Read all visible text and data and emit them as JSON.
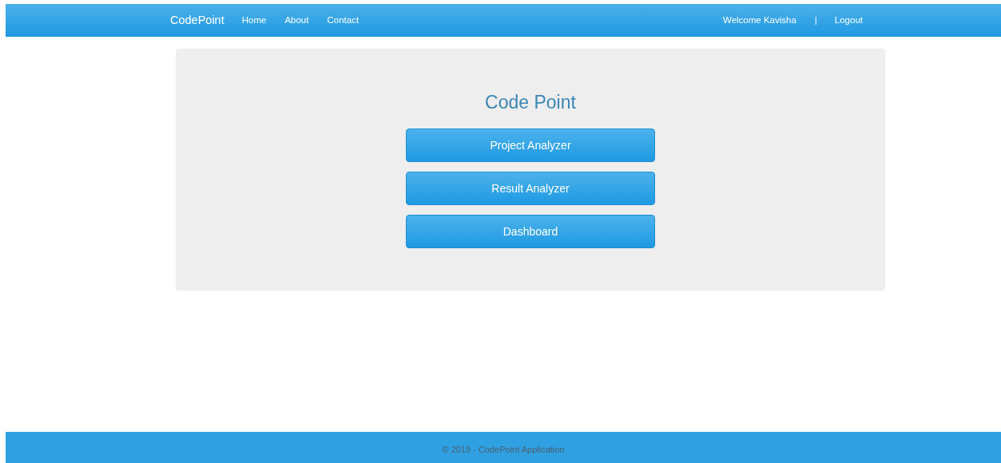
{
  "navbar": {
    "brand": "CodePoint",
    "links": [
      "Home",
      "About",
      "Contact"
    ],
    "welcome": "Welcome Kavisha",
    "separator": "|",
    "logout": "Logout"
  },
  "panel": {
    "title": "Code Point",
    "buttons": [
      "Project Analyzer",
      "Result Analyzer",
      "Dashboard"
    ]
  },
  "footer": {
    "text": "© 2019 - CodePoint Application"
  }
}
